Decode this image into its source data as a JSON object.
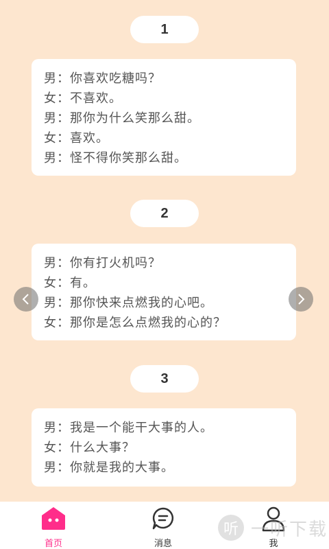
{
  "sections": [
    {
      "number": "1",
      "lines": [
        "男：你喜欢吃糖吗？",
        "女：不喜欢。",
        "男：那你为什么笑那么甜。",
        "女：喜欢。",
        "男：怪不得你笑那么甜。"
      ]
    },
    {
      "number": "2",
      "lines": [
        "男：你有打火机吗？",
        "女：有。",
        "男：那你快来点燃我的心吧。",
        "女：那你是怎么点燃我的心的？"
      ]
    },
    {
      "number": "3",
      "lines": [
        "男：我是一个能干大事的人。",
        "女：什么大事？",
        "男：你就是我的大事。"
      ]
    }
  ],
  "carousel": {
    "prev_icon": "chevron-left-icon",
    "next_icon": "chevron-right-icon"
  },
  "tabbar": {
    "items": [
      {
        "label": "首页",
        "icon": "home-icon",
        "active": true
      },
      {
        "label": "消息",
        "icon": "message-icon",
        "active": false
      },
      {
        "label": "我",
        "icon": "user-icon",
        "active": false
      }
    ]
  },
  "watermark": {
    "logo_char": "听",
    "text": "一听下载"
  },
  "colors": {
    "background": "#fde6cf",
    "accent": "#ff2d8a",
    "card": "#ffffff"
  }
}
